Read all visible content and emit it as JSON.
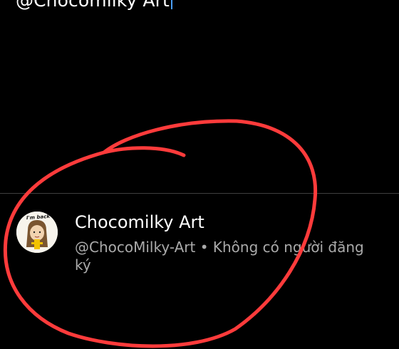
{
  "search": {
    "query": "@Chocomilky Art"
  },
  "result": {
    "channel_name": "Chocomilky Art",
    "handle": "@ChocoMilky-Art",
    "separator": " • ",
    "subscribers": "Không có người đăng ký",
    "avatar_caption": "I'm back"
  },
  "colors": {
    "background": "#000000",
    "caret": "#4a9eff",
    "divider": "#3f3f3f",
    "meta_text": "#aaaaaa",
    "annotation_stroke": "#ff3b3b"
  },
  "icons": {
    "avatar": "channel-avatar"
  }
}
